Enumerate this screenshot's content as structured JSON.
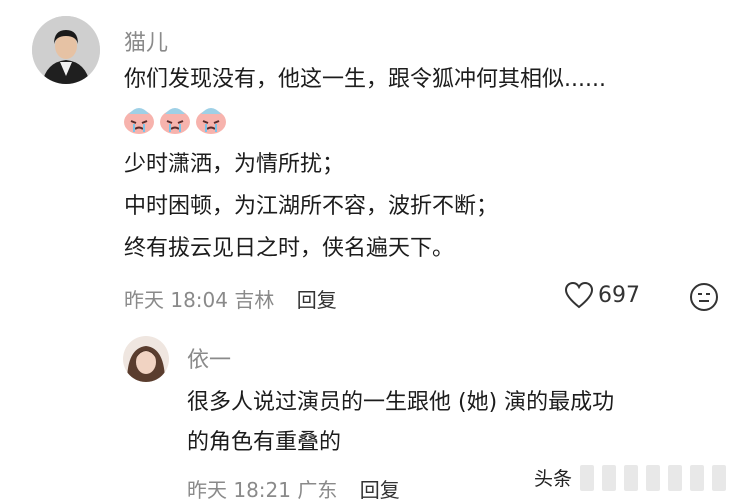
{
  "comment": {
    "username": "猫儿",
    "lines": [
      "你们发现没有，他这一生，跟令狐冲何其相似......",
      "少时潇洒，为情所扰；",
      "中时困顿，为江湖所不容，波折不断；",
      "终有拔云见日之时，侠名遍天下。"
    ],
    "emojis": [
      "crying-face-emoji",
      "crying-face-emoji",
      "crying-face-emoji"
    ],
    "time": "昨天 18:04",
    "location": "吉林",
    "reply_label": "回复",
    "like_count": "697",
    "colors": {
      "meta": "#8a8a8a",
      "text": "#1c1c1c",
      "emoji_pink": "#f4a7a3"
    }
  },
  "reply": {
    "username": "依一",
    "lines": [
      "很多人说过演员的一生跟他 (她) 演的最成功",
      "的角色有重叠的"
    ],
    "time": "昨天 18:21",
    "location": "广东",
    "reply_label": "回复"
  },
  "watermark": {
    "text": "头条"
  }
}
